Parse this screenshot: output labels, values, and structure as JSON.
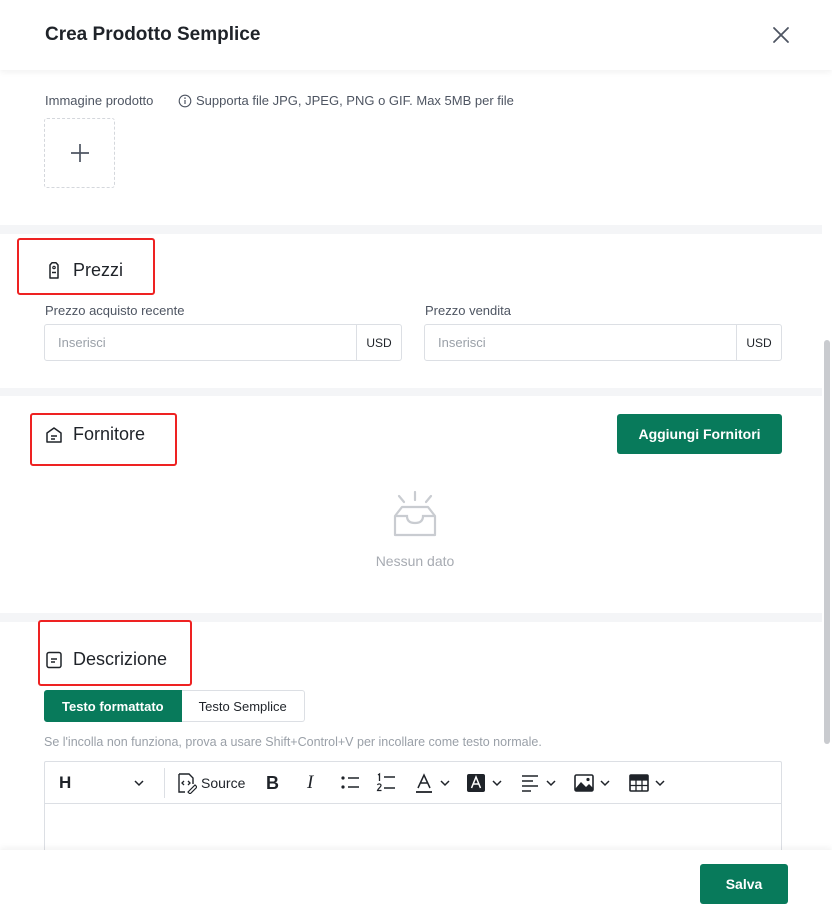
{
  "modal": {
    "title": "Crea Prodotto Semplice",
    "close_icon": "close-icon",
    "accent_color": "#087a5b",
    "highlight_color": "#ee2222"
  },
  "image_section": {
    "label": "Immagine prodotto",
    "hint": "Supporta file JPG, JPEG, PNG o GIF. Max 5MB per file",
    "hint_icon": "info-icon",
    "upload_icon": "plus-icon"
  },
  "prezzi": {
    "title": "Prezzi",
    "icon": "price-tag-icon",
    "purchase_label": "Prezzo acquisto recente",
    "purchase_placeholder": "Inserisci",
    "purchase_value": "",
    "purchase_currency": "USD",
    "sale_label": "Prezzo vendita",
    "sale_placeholder": "Inserisci",
    "sale_value": "",
    "sale_currency": "USD"
  },
  "fornitore": {
    "title": "Fornitore",
    "icon": "supplier-icon",
    "add_button": "Aggiungi Fornitori",
    "empty_text": "Nessun dato",
    "empty_icon": "empty-inbox-icon"
  },
  "descrizione": {
    "title": "Descrizione",
    "icon": "document-icon",
    "tabs": [
      "Testo formattato",
      "Testo Semplice"
    ],
    "active_tab": "Testo formattato",
    "paste_hint": "Se l'incolla non funziona, prova a usare Shift+Control+V per incollare come testo normale.",
    "toolbar": {
      "heading": "H",
      "source": "Source",
      "bold": "B",
      "italic": "I",
      "icons": [
        "heading-icon",
        "chevron-down-icon",
        "source-icon",
        "bold-icon",
        "italic-icon",
        "bulleted-list-icon",
        "numbered-list-icon",
        "font-color-icon",
        "font-background-icon",
        "align-icon",
        "image-icon",
        "table-icon"
      ]
    }
  },
  "footer": {
    "save_button": "Salva"
  }
}
